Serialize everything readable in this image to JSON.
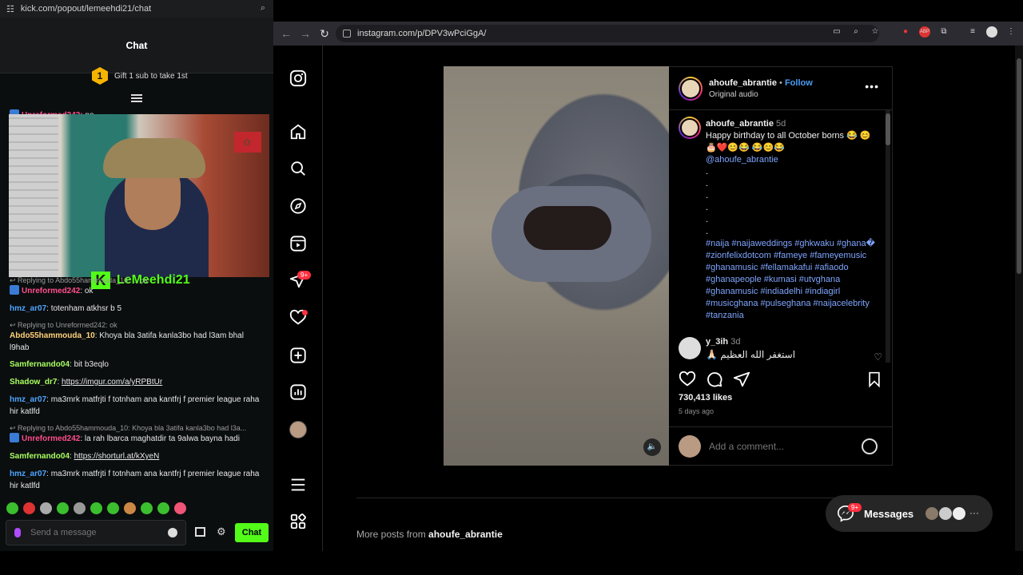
{
  "kick": {
    "url": "kick.com/popout/lemeehdi21/chat",
    "chat_title": "Chat",
    "gift_rank": "1",
    "gift_text": "Gift 1 sub to take 1st",
    "streamer_name": "LeMeehdi21",
    "kick_logo": "K",
    "messages": [
      {
        "reply": "↩ Replying to Abdo55hammouda_10: ... ça",
        "user": "Unreformed242",
        "user_color": "#ff4d8d",
        "text": "ok",
        "mod": true
      },
      {
        "reply": "",
        "user": "hmz_ar07",
        "user_color": "#4ea5ff",
        "text": "totenham atkhsr b 5",
        "mod": false
      },
      {
        "reply": "↩ Replying to Unreformed242: ok",
        "user": "Abdo55hammouda_10",
        "user_color": "#ffd27a",
        "text": "Khoya bla 3atifa kanla3bo had l3am bhal l9hab",
        "mod": false
      },
      {
        "reply": "",
        "user": "Samfernando04",
        "user_color": "#a8ff60",
        "text": "bit b3eqlo",
        "mod": false
      },
      {
        "reply": "",
        "user": "Shadow_dr7",
        "user_color": "#a8ff60",
        "text": "https://imgur.com/a/yRPBtUr",
        "mod": false,
        "link": true
      },
      {
        "reply": "",
        "user": "hmz_ar07",
        "user_color": "#4ea5ff",
        "text": "ma3mrk matfrjti f totnham ana kantfrj f premier league raha hir katlfd",
        "mod": false
      },
      {
        "reply": "↩ Replying to Abdo55hammouda_10: Khoya bla 3atifa kanla3bo had l3a...",
        "user": "Unreformed242",
        "user_color": "#ff4d8d",
        "text": "la rah lbarca maghatdir ta 9alwa bayna hadi",
        "mod": true
      },
      {
        "reply": "",
        "user": "Samfernando04",
        "user_color": "#a8ff60",
        "text": "https://shorturl.at/kXyeN",
        "mod": false,
        "link": true
      },
      {
        "reply": "",
        "user": "hmz_ar07",
        "user_color": "#4ea5ff",
        "text": "ma3mrk matfrjti f totnham ana kantfrj f premier league raha hir katlfd",
        "mod": false
      }
    ],
    "top_partial": {
      "user": "Unreformed242",
      "text": "no"
    },
    "input_placeholder": "Send a message",
    "send_label": "Chat",
    "accent": "#53fc18"
  },
  "browser": {
    "url": "instagram.com/p/DPV3wPciGgA/"
  },
  "instagram": {
    "nav_badge_9plus": "9+",
    "post": {
      "username": "ahoufe_abrantie",
      "follow_label": "Follow",
      "audio": "Original audio",
      "caption_user": "ahoufe_abrantie",
      "caption_time": "5d",
      "caption_text": "Happy birthday to all October borns 😂 😊🎂❤️😊😂 😂😊😂",
      "caption_mention": "@ahoufe_abrantie",
      "caption_dots": [
        ".",
        ".",
        ".",
        ".",
        ".",
        "."
      ],
      "hashtags": "#naija #naijaweddings #ghkwaku #ghana� #zionfelixdotcom #fameye #fameyemusic #ghanamusic #fellamakafui #afiaodo #ghanapeople #kumasi #utvghana #ghanamusic #indiadelhi #indiagirl #musicghana #pulseghana #naijacelebrity #tanzania",
      "comment_user": "y_3ih",
      "comment_time": "3d",
      "comment_text": "🙏🏻 استغفر الله العظيم",
      "likes": "730,413 likes",
      "posted_ago": "5 days ago",
      "add_comment_placeholder": "Add a comment..."
    },
    "more_posts_prefix": "More posts from",
    "more_posts_user": "ahoufe_abrantie",
    "messages_label": "Messages",
    "messages_badge": "9+"
  }
}
